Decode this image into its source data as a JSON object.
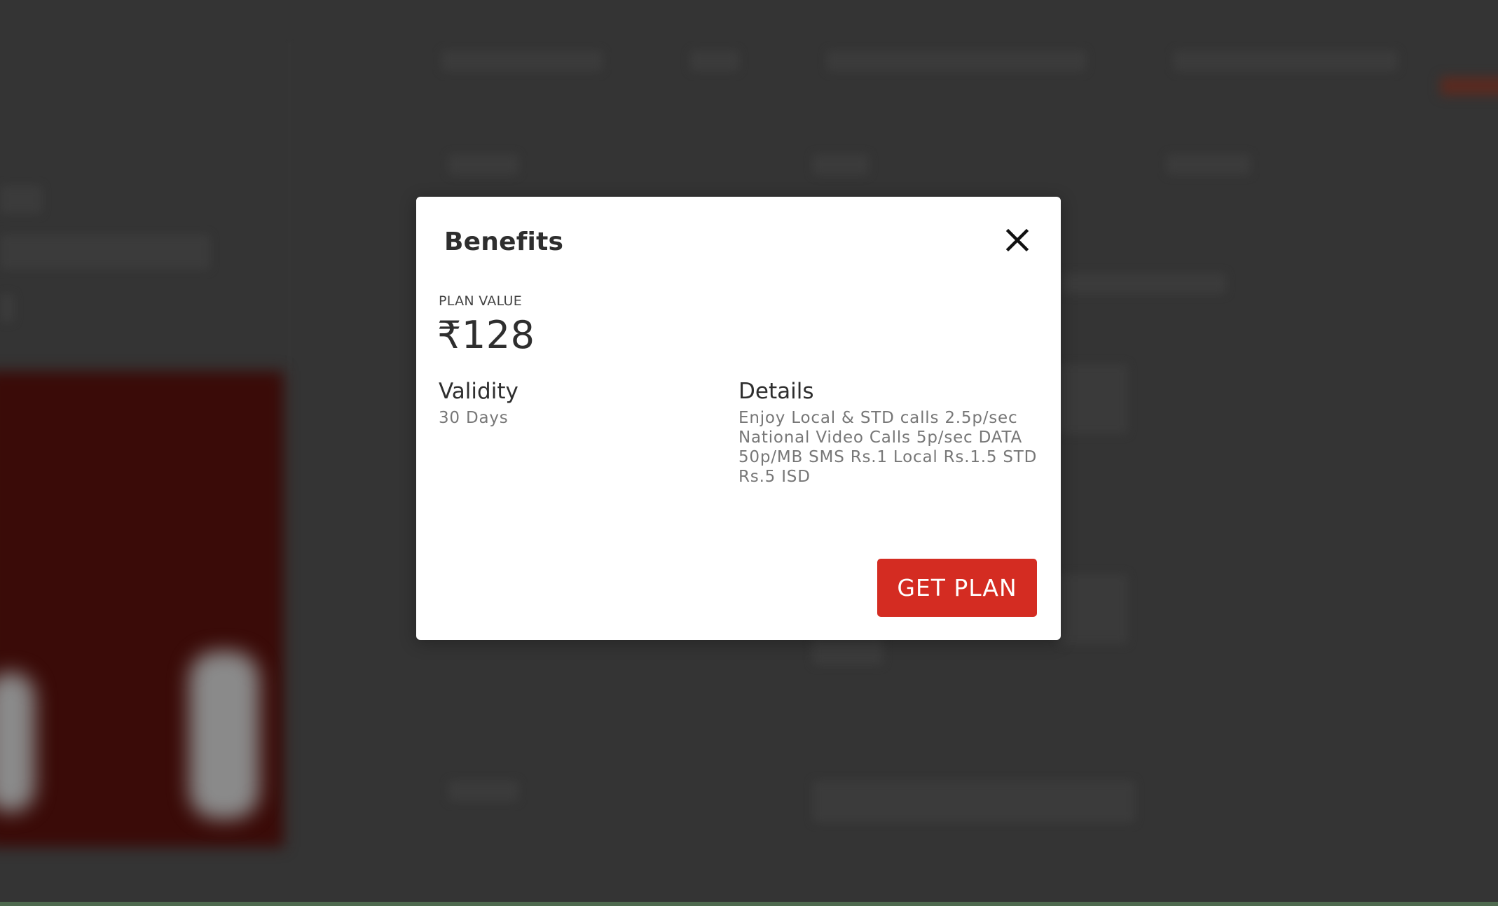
{
  "modal": {
    "title": "Benefits",
    "plan_value_label": "PLAN VALUE",
    "plan_value": "₹128",
    "validity": {
      "heading": "Validity",
      "value": "30 Days"
    },
    "details": {
      "heading": "Details",
      "value": "Enjoy Local & STD calls 2.5p/sec National Video Calls 5p/sec DATA 50p/MB SMS Rs.1 Local Rs.1.5 STD Rs.5 ISD"
    },
    "get_plan_label": "GET PLAN",
    "close_icon": "close-icon"
  },
  "colors": {
    "overlay": "#343434",
    "accent": "#d42c22",
    "modal_bg": "#ffffff"
  }
}
